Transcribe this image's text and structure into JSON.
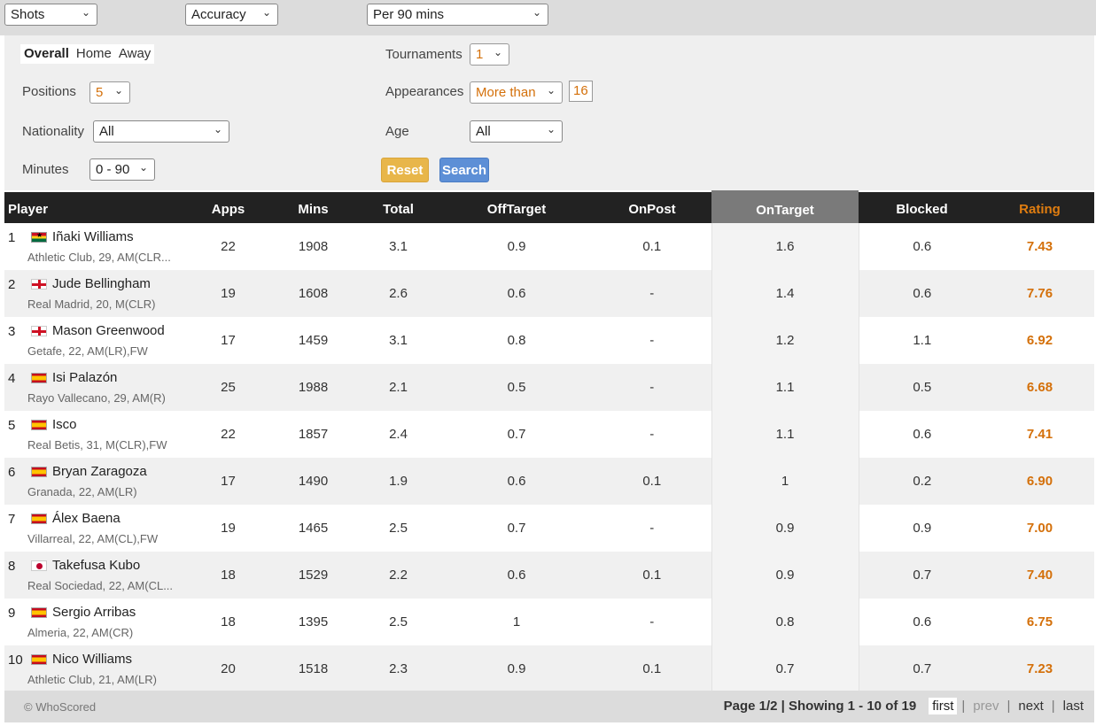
{
  "topbar": {
    "category": "Shots",
    "subcategory": "Accuracy",
    "stat_mode": "Per 90 mins"
  },
  "filters": {
    "tabs": [
      "Overall",
      "Home",
      "Away"
    ],
    "active_tab": "Overall",
    "positions_label": "Positions",
    "positions_value": "5",
    "nationality_label": "Nationality",
    "nationality_value": "All",
    "minutes_label": "Minutes",
    "minutes_value": "0 - 90",
    "tournaments_label": "Tournaments",
    "tournaments_value": "1",
    "appearances_label": "Appearances",
    "appearances_mode": "More than",
    "appearances_value": "16",
    "age_label": "Age",
    "age_value": "All",
    "reset_label": "Reset",
    "search_label": "Search"
  },
  "table": {
    "headers": [
      "Player",
      "Apps",
      "Mins",
      "Total",
      "OffTarget",
      "OnPost",
      "OnTarget",
      "Blocked",
      "Rating"
    ],
    "sorted_column": "OnTarget",
    "rows": [
      {
        "rank": "1",
        "flag": "gh",
        "name": "Iñaki Williams",
        "info": "Athletic Club,  29, AM(CLR...",
        "apps": "22",
        "mins": "1908",
        "total": "3.1",
        "off": "0.9",
        "post": "0.1",
        "on": "1.6",
        "blocked": "0.6",
        "rating": "7.43"
      },
      {
        "rank": "2",
        "flag": "en",
        "name": "Jude Bellingham",
        "info": "Real Madrid,  20, M(CLR)",
        "apps": "19",
        "mins": "1608",
        "total": "2.6",
        "off": "0.6",
        "post": "-",
        "on": "1.4",
        "blocked": "0.6",
        "rating": "7.76"
      },
      {
        "rank": "3",
        "flag": "en",
        "name": "Mason Greenwood",
        "info": "Getafe,  22, AM(LR),FW",
        "apps": "17",
        "mins": "1459",
        "total": "3.1",
        "off": "0.8",
        "post": "-",
        "on": "1.2",
        "blocked": "1.1",
        "rating": "6.92"
      },
      {
        "rank": "4",
        "flag": "es",
        "name": "Isi Palazón",
        "info": "Rayo Vallecano,  29, AM(R)",
        "apps": "25",
        "mins": "1988",
        "total": "2.1",
        "off": "0.5",
        "post": "-",
        "on": "1.1",
        "blocked": "0.5",
        "rating": "6.68"
      },
      {
        "rank": "5",
        "flag": "es",
        "name": "Isco",
        "info": "Real Betis,  31, M(CLR),FW",
        "apps": "22",
        "mins": "1857",
        "total": "2.4",
        "off": "0.7",
        "post": "-",
        "on": "1.1",
        "blocked": "0.6",
        "rating": "7.41"
      },
      {
        "rank": "6",
        "flag": "es",
        "name": "Bryan Zaragoza",
        "info": "Granada,  22, AM(LR)",
        "apps": "17",
        "mins": "1490",
        "total": "1.9",
        "off": "0.6",
        "post": "0.1",
        "on": "1",
        "blocked": "0.2",
        "rating": "6.90"
      },
      {
        "rank": "7",
        "flag": "es",
        "name": "Álex Baena",
        "info": "Villarreal,  22, AM(CL),FW",
        "apps": "19",
        "mins": "1465",
        "total": "2.5",
        "off": "0.7",
        "post": "-",
        "on": "0.9",
        "blocked": "0.9",
        "rating": "7.00"
      },
      {
        "rank": "8",
        "flag": "jp",
        "name": "Takefusa Kubo",
        "info": "Real Sociedad,  22, AM(CL...",
        "apps": "18",
        "mins": "1529",
        "total": "2.2",
        "off": "0.6",
        "post": "0.1",
        "on": "0.9",
        "blocked": "0.7",
        "rating": "7.40"
      },
      {
        "rank": "9",
        "flag": "es",
        "name": "Sergio Arribas",
        "info": "Almeria,  22, AM(CR)",
        "apps": "18",
        "mins": "1395",
        "total": "2.5",
        "off": "1",
        "post": "-",
        "on": "0.8",
        "blocked": "0.6",
        "rating": "6.75"
      },
      {
        "rank": "10",
        "flag": "es",
        "name": "Nico Williams",
        "info": "Athletic Club,  21, AM(LR)",
        "apps": "20",
        "mins": "1518",
        "total": "2.3",
        "off": "0.9",
        "post": "0.1",
        "on": "0.7",
        "blocked": "0.7",
        "rating": "7.23"
      }
    ]
  },
  "footer": {
    "copyright": "© WhoScored",
    "page_info": "Page 1/2 | Showing 1 - 10 of 19",
    "first": "first",
    "prev": "prev",
    "next": "next",
    "last": "last",
    "separator": "|"
  },
  "colors": {
    "accent_orange": "#d4700a",
    "header_bg": "#222222",
    "sorted_header_bg": "#7a7a7a",
    "reset_button": "#e8b64a",
    "search_button": "#5d8fd6"
  }
}
